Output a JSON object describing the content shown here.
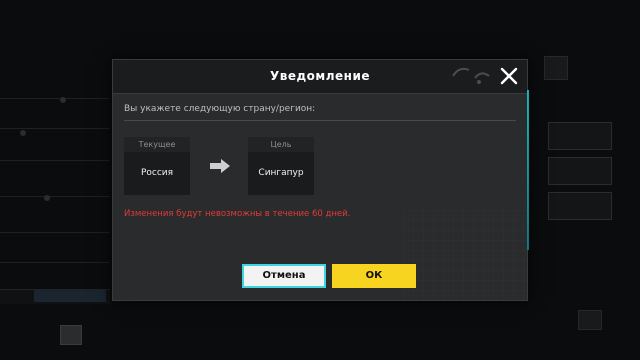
{
  "dialog": {
    "title": "Уведомление",
    "close_icon": "close-icon",
    "prompt": "Вы укажете следующую страну/регион:",
    "current": {
      "caption": "Текущее",
      "value": "Россия"
    },
    "target": {
      "caption": "Цель",
      "value": "Сингапур"
    },
    "arrow_icon": "arrow-right-icon",
    "warning": "Изменения будут невозможны в течение 60 дней.",
    "buttons": {
      "cancel": "Отмена",
      "ok": "ОК"
    }
  },
  "colors": {
    "warning": "#e23a3a",
    "ok_button": "#f7d41f",
    "cancel_border": "#3fd5de",
    "dialog_bg": "#2a2b2c",
    "header_bg": "#1b1c1d"
  }
}
